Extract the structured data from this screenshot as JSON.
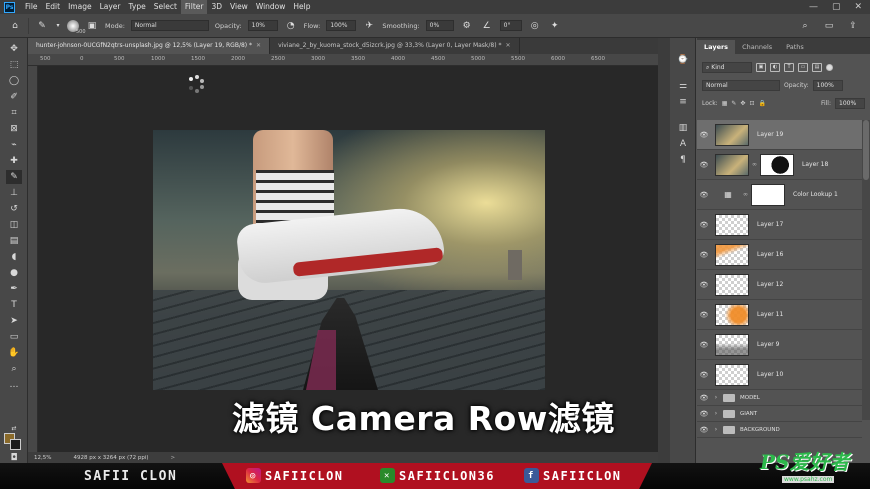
{
  "menubar": {
    "logo": "Ps",
    "items": [
      "File",
      "Edit",
      "Image",
      "Layer",
      "Type",
      "Select",
      "Filter",
      "3D",
      "View",
      "Window",
      "Help"
    ],
    "active": "Filter",
    "controls": [
      "—",
      "▢",
      "✕"
    ]
  },
  "options": {
    "brush_size": "500",
    "mode_label": "Mode:",
    "mode_value": "Normal",
    "opacity_label": "Opacity:",
    "opacity_value": "10%",
    "flow_label": "Flow:",
    "flow_value": "100%",
    "smoothing_label": "Smoothing:",
    "smoothing_value": "0%",
    "angle_value": "0°"
  },
  "tabs": [
    {
      "label": "hunter-johnson-0UCGfN2qtrs-unsplash.jpg @ 12,5% (Layer 19, RGB/8) *",
      "active": true
    },
    {
      "label": "viviane_2_by_kuoma_stock_d5izcrk.jpg @ 33,3% (Layer 0, Layer Mask/8) *",
      "active": false
    }
  ],
  "ruler": [
    "500",
    "0",
    "500",
    "1000",
    "1500",
    "2000",
    "2500",
    "3000",
    "3500",
    "4000",
    "4500",
    "5000",
    "5500",
    "6000",
    "6500"
  ],
  "status": {
    "zoom": "12,5%",
    "doc_info": "4928 px x 3264 px (72 ppi)",
    "arrow": ">"
  },
  "subtitle": "滤镜  Camera Row滤镜",
  "panel": {
    "tabs": [
      "Layers",
      "Channels",
      "Paths"
    ],
    "kind": "Kind",
    "blend": "Normal",
    "opacity_label": "Opacity:",
    "opacity_value": "100%",
    "lock_label": "Lock:",
    "fill_label": "Fill:",
    "fill_value": "100%",
    "layers": [
      {
        "name": "Layer 19",
        "selected": true
      },
      {
        "name": "Layer 18"
      },
      {
        "name": "Color Lookup 1"
      },
      {
        "name": "Layer 17"
      },
      {
        "name": "Layer 16"
      },
      {
        "name": "Layer 12"
      },
      {
        "name": "Layer 11"
      },
      {
        "name": "Layer 9"
      },
      {
        "name": "Layer 10"
      }
    ],
    "groups": [
      "MODEL",
      "GIANT",
      "BACKGROUND"
    ]
  },
  "banner": {
    "name": "SAFII CLON",
    "instagram": "SAFIICLON",
    "xbox": "SAFIICLON36",
    "facebook": "SAFIICLON"
  },
  "watermark": {
    "main": "PS爱好者",
    "sub": "www.psahz.com"
  },
  "colors": {
    "accent_red": "#b01020",
    "watermark_green": "#2db84b",
    "foreground_swatch": "#8a6a2a",
    "background_swatch": "#1b1b1b"
  }
}
